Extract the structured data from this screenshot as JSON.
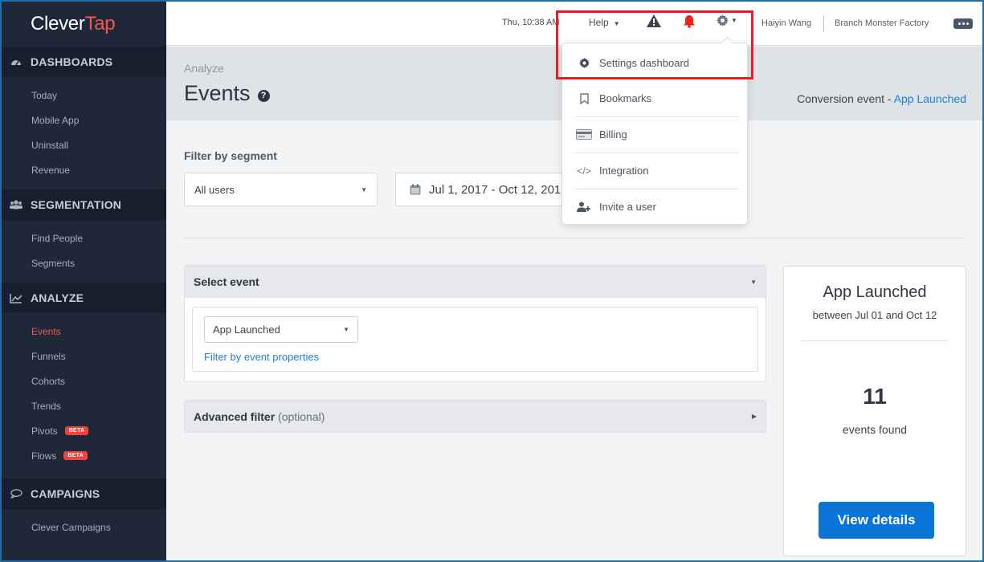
{
  "app": {
    "logo_part1": "Clever",
    "logo_part2": "Tap"
  },
  "sidebar": {
    "sections": [
      {
        "title": "DASHBOARDS",
        "icon": "dashboard-gauge-icon",
        "items": [
          {
            "label": "Today"
          },
          {
            "label": "Mobile App"
          },
          {
            "label": "Uninstall"
          },
          {
            "label": "Revenue"
          }
        ]
      },
      {
        "title": "SEGMENTATION",
        "icon": "users-group-icon",
        "items": [
          {
            "label": "Find People"
          },
          {
            "label": "Segments"
          }
        ]
      },
      {
        "title": "ANALYZE",
        "icon": "line-chart-icon",
        "items": [
          {
            "label": "Events",
            "active": true
          },
          {
            "label": "Funnels"
          },
          {
            "label": "Cohorts"
          },
          {
            "label": "Trends"
          },
          {
            "label": "Pivots",
            "badge": "BETA"
          },
          {
            "label": "Flows",
            "badge": "BETA"
          }
        ]
      },
      {
        "title": "CAMPAIGNS",
        "icon": "speech-bubble-icon",
        "items": [
          {
            "label": "Clever Campaigns"
          }
        ]
      }
    ]
  },
  "topbar": {
    "time": "Thu, 10:38 AM",
    "help_label": "Help",
    "user_name": "Haiyin Wang",
    "account_name": "Branch Monster Factory",
    "notification_color": "#f0231b"
  },
  "settings_menu": {
    "items": [
      {
        "label": "Settings dashboard",
        "icon": "gear-icon"
      },
      {
        "label": "Bookmarks",
        "icon": "bookmark-icon"
      },
      {
        "label": "Billing",
        "icon": "credit-card-icon"
      },
      {
        "label": "Integration",
        "icon": "code-icon"
      },
      {
        "label": "Invite a user",
        "icon": "user-plus-icon"
      }
    ],
    "highlight_color": "#ee1b24"
  },
  "page": {
    "breadcrumb": "Analyze",
    "title": "Events",
    "conversion_prefix": "Conversion event - ",
    "conversion_event": "App Launched"
  },
  "filters": {
    "segment_label": "Filter by segment",
    "segment_value": "All users",
    "date_range": "Jul 1, 2017 - Oct 12, 2017"
  },
  "select_event": {
    "header": "Select event",
    "event_value": "App Launched",
    "filter_link": "Filter by event properties"
  },
  "advanced_filter": {
    "label": "Advanced filter",
    "optional": "(optional)"
  },
  "summary_card": {
    "title": "App Launched",
    "subtitle": "between Jul 01 and Oct 12",
    "count": "11",
    "count_label": "events found",
    "button_label": "View details",
    "button_color": "#0a74d9"
  }
}
